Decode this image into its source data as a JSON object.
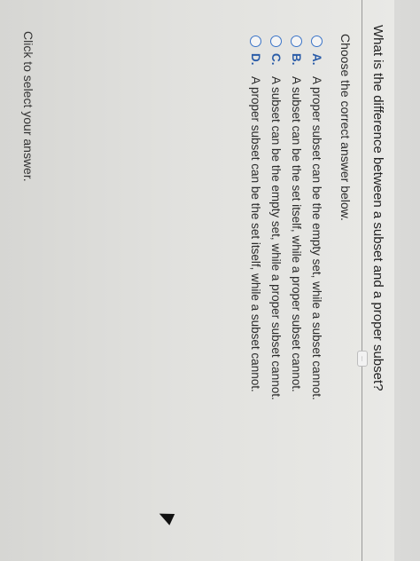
{
  "question": "What is the difference between a subset and a proper subset?",
  "instruction": "Choose the correct answer below.",
  "options": [
    {
      "letter": "A.",
      "text": "A proper subset can be the empty set, while a subset cannot."
    },
    {
      "letter": "B.",
      "text": "A subset can be the set itself, while a proper subset cannot."
    },
    {
      "letter": "C.",
      "text": "A subset can be the empty set, while a proper subset cannot."
    },
    {
      "letter": "D.",
      "text": "A proper subset can be the set itself, while a subset cannot."
    }
  ],
  "more_indicator": "...",
  "footer": "Click to select your answer.",
  "taskbar": {
    "icons": [
      "chrome-icon",
      "gmail-icon",
      "docs-icon",
      "slides-icon"
    ],
    "gmail_glyph": "M"
  },
  "colors": {
    "radio": "#3a74c8",
    "letter": "#2a5ca8"
  }
}
